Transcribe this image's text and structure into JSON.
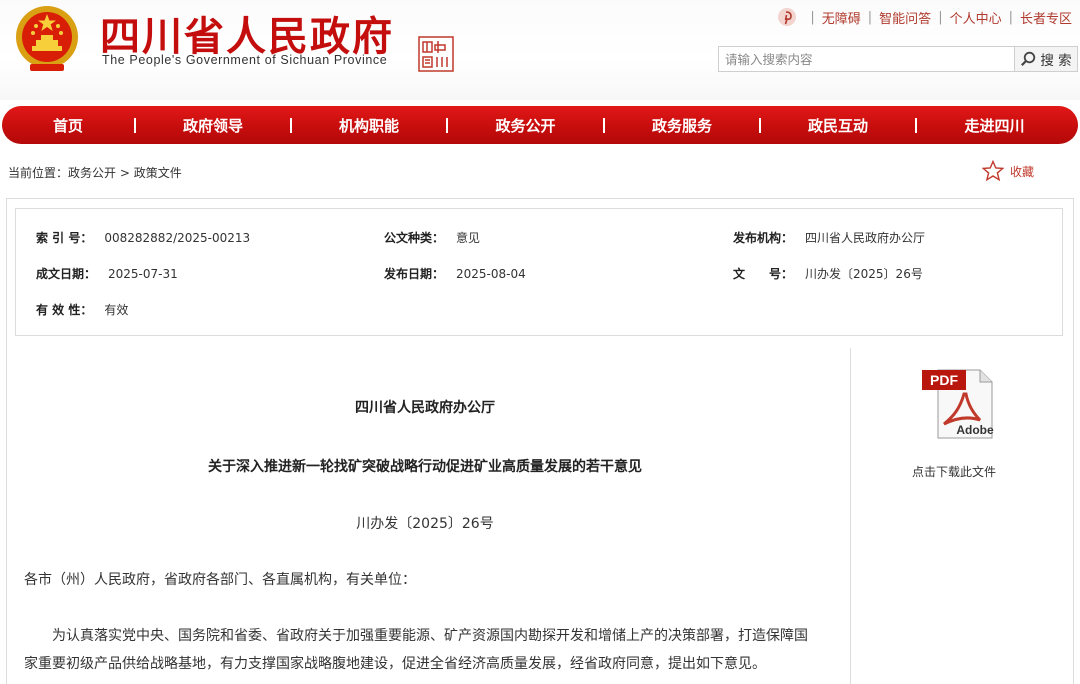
{
  "header": {
    "site_title": "四川省人民政府",
    "site_subtitle": "The People's Government of Sichuan Province",
    "seal_text": "中国四川",
    "top_links": [
      "无障碍",
      "智能问答",
      "个人中心",
      "长者专区"
    ],
    "search": {
      "placeholder": "请输入搜索内容",
      "button_label": "搜 索"
    }
  },
  "nav": {
    "items": [
      "首页",
      "政府领导",
      "机构职能",
      "政务公开",
      "政务服务",
      "政民互动",
      "走进四川"
    ]
  },
  "breadcrumb": {
    "prefix": "当前位置：",
    "items": [
      "政务公开",
      "政策文件"
    ],
    "separator": " > "
  },
  "favorite_label": "收藏",
  "meta": {
    "index_no": {
      "label": "索 引 号：",
      "value": "008282882/2025-00213"
    },
    "doc_type": {
      "label": "公文种类：",
      "value": "意见"
    },
    "publisher": {
      "label": "发布机构：",
      "value": "四川省人民政府办公厅"
    },
    "created": {
      "label": "成文日期：",
      "value": "2025-07-31"
    },
    "published": {
      "label": "发布日期：",
      "value": "2025-08-04"
    },
    "doc_no": {
      "label": "文　　号：",
      "value": "川办发〔2025〕26号"
    },
    "validity": {
      "label": "有 效 性：",
      "value": "有效"
    }
  },
  "document": {
    "issuer": "四川省人民政府办公厅",
    "title": "关于深入推进新一轮找矿突破战略行动促进矿业高质量发展的若干意见",
    "number": "川办发〔2025〕26号",
    "salutation": "各市（州）人民政府，省政府各部门、各直属机构，有关单位：",
    "para1_line1": "为认真落实党中央、国务院和省委、省政府关于加强重要能源、矿产资源国内勘探开发和增储上产的决策部署，打造保障国",
    "para1_line2": "家重要初级产品供给战略基地，有力支撑国家战略腹地建设，促进全省经济高质量发展，经省政府同意，提出如下意见。"
  },
  "download": {
    "pdf_badge": "PDF",
    "adobe_label": "Adobe",
    "caption": "点击下载此文件"
  },
  "colors": {
    "brand_red": "#c40d0d",
    "nav_red": "#d41212",
    "link_red": "#b03a2e"
  }
}
